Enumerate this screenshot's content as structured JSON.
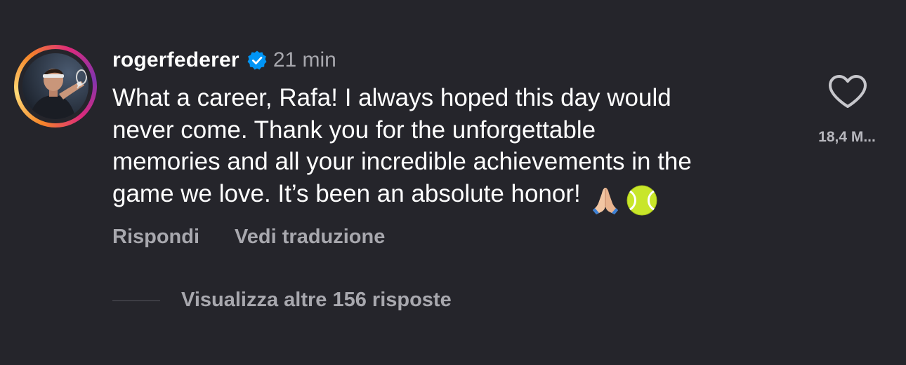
{
  "comment": {
    "username": "rogerfederer",
    "verified_icon": "verified-badge-icon",
    "time": "21 min",
    "text_lines": [
      "What a career, Rafa! I always hoped this day would",
      "never come. Thank you for the unforgettable",
      "memories and all your incredible achievements in the",
      "game we love. It’s been an absolute honor!"
    ],
    "emojis": [
      "folded-hands-emoji",
      "tennis-ball-emoji"
    ],
    "like_icon": "heart-outline-icon",
    "like_count": "18,4 M..."
  },
  "actions": {
    "reply_label": "Rispondi",
    "translate_label": "Vedi traduzione"
  },
  "replies": {
    "label": "Visualizza altre 156 risposte"
  },
  "colors": {
    "background": "#25252b",
    "text_primary": "#ffffff",
    "text_secondary": "#a8a8ae",
    "verified_blue": "#0095f6"
  }
}
